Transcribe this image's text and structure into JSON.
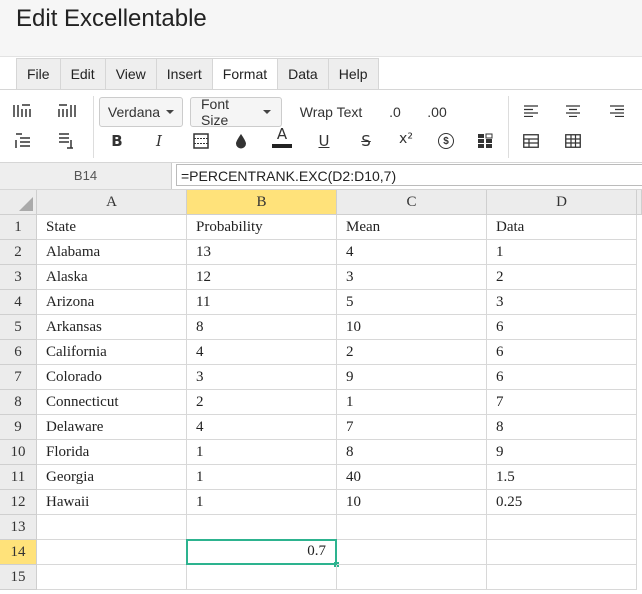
{
  "app": {
    "title": "Edit Excellentable"
  },
  "menu": {
    "tabs": [
      "File",
      "Edit",
      "View",
      "Insert",
      "Format",
      "Data",
      "Help"
    ],
    "active": "Format"
  },
  "toolbar": {
    "font_family": "Verdana",
    "font_size": "Font Size",
    "wrap_text": "Wrap Text",
    "decrease_decimal": ".0",
    "increase_decimal": ".00",
    "bold": "B",
    "italic": "I",
    "font_color": "A",
    "underline": "U",
    "strikethrough": "S",
    "superscript": "x²",
    "currency": "$"
  },
  "formula_bar": {
    "cell_ref": "B14",
    "formula": "=PERCENTRANK.EXC(D2:D10,7)"
  },
  "sheet": {
    "columns": [
      "A",
      "B",
      "C",
      "D"
    ],
    "selected_column": "B",
    "selected_row": "14",
    "row_numbers": [
      "1",
      "2",
      "3",
      "4",
      "5",
      "6",
      "7",
      "8",
      "9",
      "10",
      "11",
      "12",
      "13",
      "14",
      "15"
    ],
    "rows": [
      [
        "State",
        "Probability",
        "Mean",
        "Data"
      ],
      [
        "Alabama",
        "13",
        "4",
        "1"
      ],
      [
        "Alaska",
        "12",
        "3",
        "2"
      ],
      [
        "Arizona",
        "11",
        "5",
        "3"
      ],
      [
        "Arkansas",
        "8",
        "10",
        "6"
      ],
      [
        "California",
        "4",
        "2",
        "6"
      ],
      [
        "Colorado",
        "3",
        "9",
        "6"
      ],
      [
        "Connecticut",
        "2",
        "1",
        "7"
      ],
      [
        "Delaware",
        "4",
        "7",
        "8"
      ],
      [
        "Florida",
        "1",
        "8",
        "9"
      ],
      [
        "Georgia",
        "1",
        "40",
        "1.5"
      ],
      [
        "Hawaii",
        "1",
        "10",
        "0.25"
      ],
      [
        "",
        "",
        "",
        ""
      ],
      [
        "",
        "0.7",
        "",
        ""
      ],
      [
        "",
        "",
        "",
        ""
      ]
    ]
  }
}
